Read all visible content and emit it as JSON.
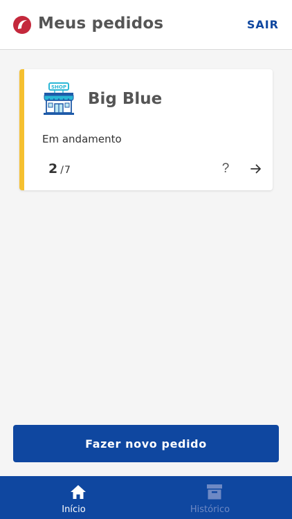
{
  "header": {
    "title": "Meus pedidos",
    "logout_label": "SAIR"
  },
  "order_card": {
    "store_name": "Big Blue",
    "status": "Em andamento",
    "progress_current": "2",
    "progress_separator": "/",
    "progress_total": "7",
    "help_label": "?",
    "shop_sign_text": "SHOP",
    "accent_color": "#f5c030"
  },
  "primary_action": {
    "label": "Fazer novo pedido"
  },
  "tabbar": {
    "tabs": [
      {
        "label": "Início",
        "icon": "home-icon",
        "active": true
      },
      {
        "label": "Histórico",
        "icon": "archive-icon",
        "active": false
      }
    ]
  },
  "colors": {
    "brand_blue": "#0f47a0",
    "brand_red": "#c4283c",
    "inactive_tab": "#6e89c4"
  }
}
